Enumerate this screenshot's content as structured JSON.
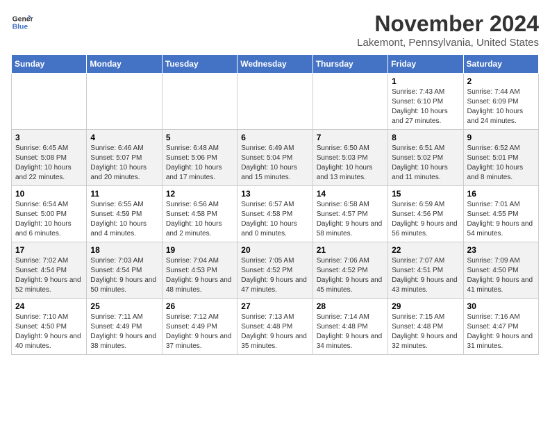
{
  "header": {
    "logo_line1": "General",
    "logo_line2": "Blue",
    "month": "November 2024",
    "location": "Lakemont, Pennsylvania, United States"
  },
  "weekdays": [
    "Sunday",
    "Monday",
    "Tuesday",
    "Wednesday",
    "Thursday",
    "Friday",
    "Saturday"
  ],
  "weeks": [
    [
      {
        "day": "",
        "sunrise": "",
        "sunset": "",
        "daylight": ""
      },
      {
        "day": "",
        "sunrise": "",
        "sunset": "",
        "daylight": ""
      },
      {
        "day": "",
        "sunrise": "",
        "sunset": "",
        "daylight": ""
      },
      {
        "day": "",
        "sunrise": "",
        "sunset": "",
        "daylight": ""
      },
      {
        "day": "",
        "sunrise": "",
        "sunset": "",
        "daylight": ""
      },
      {
        "day": "1",
        "sunrise": "Sunrise: 7:43 AM",
        "sunset": "Sunset: 6:10 PM",
        "daylight": "Daylight: 10 hours and 27 minutes."
      },
      {
        "day": "2",
        "sunrise": "Sunrise: 7:44 AM",
        "sunset": "Sunset: 6:09 PM",
        "daylight": "Daylight: 10 hours and 24 minutes."
      }
    ],
    [
      {
        "day": "3",
        "sunrise": "Sunrise: 6:45 AM",
        "sunset": "Sunset: 5:08 PM",
        "daylight": "Daylight: 10 hours and 22 minutes."
      },
      {
        "day": "4",
        "sunrise": "Sunrise: 6:46 AM",
        "sunset": "Sunset: 5:07 PM",
        "daylight": "Daylight: 10 hours and 20 minutes."
      },
      {
        "day": "5",
        "sunrise": "Sunrise: 6:48 AM",
        "sunset": "Sunset: 5:06 PM",
        "daylight": "Daylight: 10 hours and 17 minutes."
      },
      {
        "day": "6",
        "sunrise": "Sunrise: 6:49 AM",
        "sunset": "Sunset: 5:04 PM",
        "daylight": "Daylight: 10 hours and 15 minutes."
      },
      {
        "day": "7",
        "sunrise": "Sunrise: 6:50 AM",
        "sunset": "Sunset: 5:03 PM",
        "daylight": "Daylight: 10 hours and 13 minutes."
      },
      {
        "day": "8",
        "sunrise": "Sunrise: 6:51 AM",
        "sunset": "Sunset: 5:02 PM",
        "daylight": "Daylight: 10 hours and 11 minutes."
      },
      {
        "day": "9",
        "sunrise": "Sunrise: 6:52 AM",
        "sunset": "Sunset: 5:01 PM",
        "daylight": "Daylight: 10 hours and 8 minutes."
      }
    ],
    [
      {
        "day": "10",
        "sunrise": "Sunrise: 6:54 AM",
        "sunset": "Sunset: 5:00 PM",
        "daylight": "Daylight: 10 hours and 6 minutes."
      },
      {
        "day": "11",
        "sunrise": "Sunrise: 6:55 AM",
        "sunset": "Sunset: 4:59 PM",
        "daylight": "Daylight: 10 hours and 4 minutes."
      },
      {
        "day": "12",
        "sunrise": "Sunrise: 6:56 AM",
        "sunset": "Sunset: 4:58 PM",
        "daylight": "Daylight: 10 hours and 2 minutes."
      },
      {
        "day": "13",
        "sunrise": "Sunrise: 6:57 AM",
        "sunset": "Sunset: 4:58 PM",
        "daylight": "Daylight: 10 hours and 0 minutes."
      },
      {
        "day": "14",
        "sunrise": "Sunrise: 6:58 AM",
        "sunset": "Sunset: 4:57 PM",
        "daylight": "Daylight: 9 hours and 58 minutes."
      },
      {
        "day": "15",
        "sunrise": "Sunrise: 6:59 AM",
        "sunset": "Sunset: 4:56 PM",
        "daylight": "Daylight: 9 hours and 56 minutes."
      },
      {
        "day": "16",
        "sunrise": "Sunrise: 7:01 AM",
        "sunset": "Sunset: 4:55 PM",
        "daylight": "Daylight: 9 hours and 54 minutes."
      }
    ],
    [
      {
        "day": "17",
        "sunrise": "Sunrise: 7:02 AM",
        "sunset": "Sunset: 4:54 PM",
        "daylight": "Daylight: 9 hours and 52 minutes."
      },
      {
        "day": "18",
        "sunrise": "Sunrise: 7:03 AM",
        "sunset": "Sunset: 4:54 PM",
        "daylight": "Daylight: 9 hours and 50 minutes."
      },
      {
        "day": "19",
        "sunrise": "Sunrise: 7:04 AM",
        "sunset": "Sunset: 4:53 PM",
        "daylight": "Daylight: 9 hours and 48 minutes."
      },
      {
        "day": "20",
        "sunrise": "Sunrise: 7:05 AM",
        "sunset": "Sunset: 4:52 PM",
        "daylight": "Daylight: 9 hours and 47 minutes."
      },
      {
        "day": "21",
        "sunrise": "Sunrise: 7:06 AM",
        "sunset": "Sunset: 4:52 PM",
        "daylight": "Daylight: 9 hours and 45 minutes."
      },
      {
        "day": "22",
        "sunrise": "Sunrise: 7:07 AM",
        "sunset": "Sunset: 4:51 PM",
        "daylight": "Daylight: 9 hours and 43 minutes."
      },
      {
        "day": "23",
        "sunrise": "Sunrise: 7:09 AM",
        "sunset": "Sunset: 4:50 PM",
        "daylight": "Daylight: 9 hours and 41 minutes."
      }
    ],
    [
      {
        "day": "24",
        "sunrise": "Sunrise: 7:10 AM",
        "sunset": "Sunset: 4:50 PM",
        "daylight": "Daylight: 9 hours and 40 minutes."
      },
      {
        "day": "25",
        "sunrise": "Sunrise: 7:11 AM",
        "sunset": "Sunset: 4:49 PM",
        "daylight": "Daylight: 9 hours and 38 minutes."
      },
      {
        "day": "26",
        "sunrise": "Sunrise: 7:12 AM",
        "sunset": "Sunset: 4:49 PM",
        "daylight": "Daylight: 9 hours and 37 minutes."
      },
      {
        "day": "27",
        "sunrise": "Sunrise: 7:13 AM",
        "sunset": "Sunset: 4:48 PM",
        "daylight": "Daylight: 9 hours and 35 minutes."
      },
      {
        "day": "28",
        "sunrise": "Sunrise: 7:14 AM",
        "sunset": "Sunset: 4:48 PM",
        "daylight": "Daylight: 9 hours and 34 minutes."
      },
      {
        "day": "29",
        "sunrise": "Sunrise: 7:15 AM",
        "sunset": "Sunset: 4:48 PM",
        "daylight": "Daylight: 9 hours and 32 minutes."
      },
      {
        "day": "30",
        "sunrise": "Sunrise: 7:16 AM",
        "sunset": "Sunset: 4:47 PM",
        "daylight": "Daylight: 9 hours and 31 minutes."
      }
    ]
  ]
}
